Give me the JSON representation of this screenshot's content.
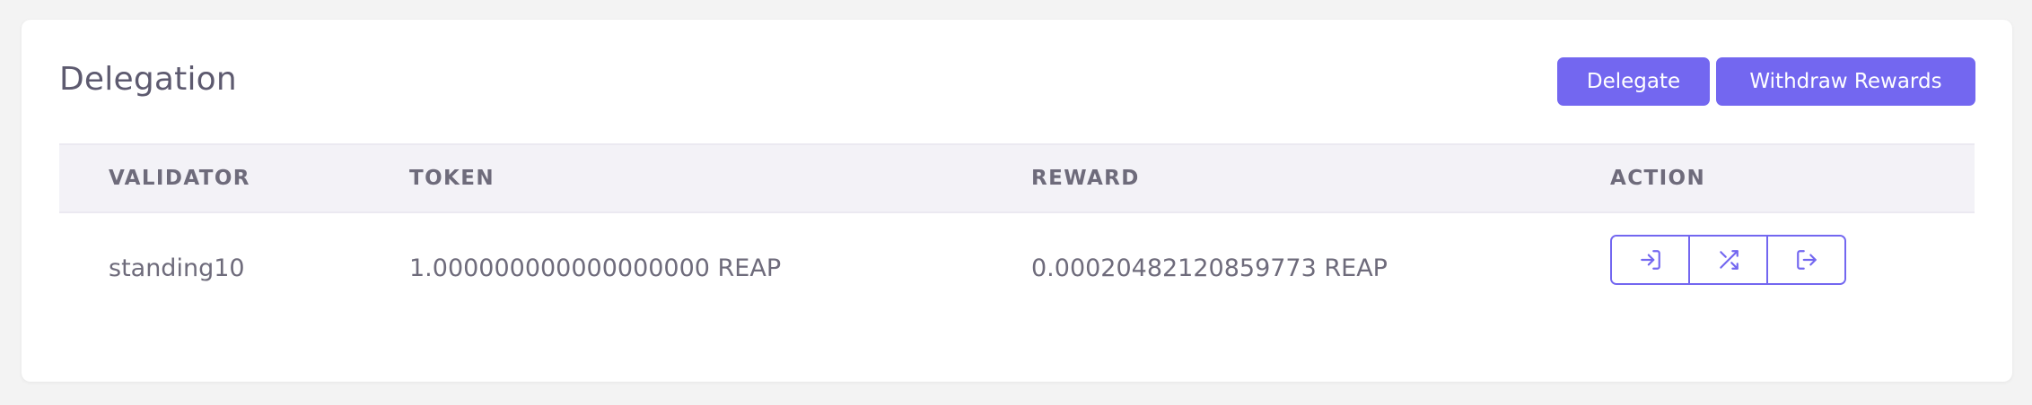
{
  "panel": {
    "title": "Delegation",
    "buttons": {
      "delegate": "Delegate",
      "withdraw_rewards": "Withdraw Rewards"
    }
  },
  "table": {
    "columns": [
      "VALIDATOR",
      "TOKEN",
      "REWARD",
      "ACTION"
    ],
    "rows": [
      {
        "validator": "standing10",
        "token": "1.000000000000000000 REAP",
        "reward": "0.00020482120859773 REAP",
        "actions": [
          "log-in-icon",
          "shuffle-icon",
          "log-out-icon"
        ]
      }
    ]
  },
  "colors": {
    "accent": "#7367f0",
    "text": "#6e6b7b",
    "header_bg": "#f3f2f7",
    "page_bg": "#f3f3f3"
  }
}
